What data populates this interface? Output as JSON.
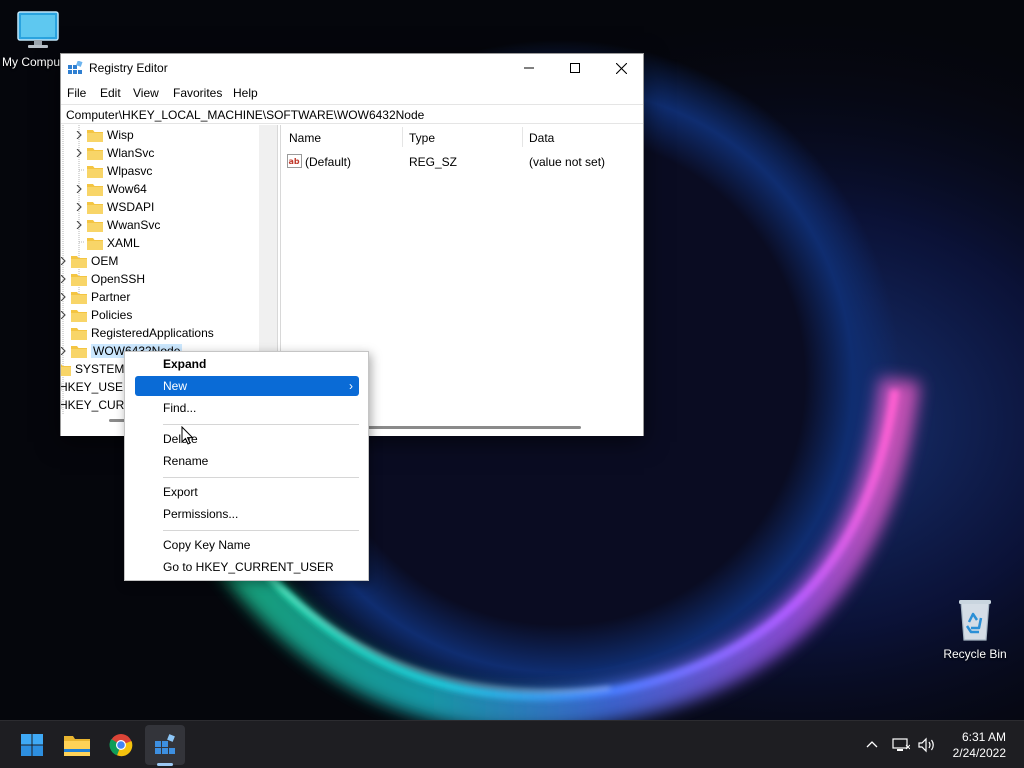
{
  "desktop": {
    "icons": [
      {
        "label": "My Computer"
      },
      {
        "label": "Recycle Bin"
      }
    ]
  },
  "window": {
    "title": "Registry Editor",
    "menu": [
      "File",
      "Edit",
      "View",
      "Favorites",
      "Help"
    ],
    "address": "Computer\\HKEY_LOCAL_MACHINE\\SOFTWARE\\WOW6432Node",
    "tree": [
      {
        "label": "Wisp",
        "expandable": true
      },
      {
        "label": "WlanSvc",
        "expandable": true
      },
      {
        "label": "Wlpasvc",
        "expandable": false
      },
      {
        "label": "Wow64",
        "expandable": true
      },
      {
        "label": "WSDAPI",
        "expandable": true
      },
      {
        "label": "WwanSvc",
        "expandable": true
      },
      {
        "label": "XAML",
        "expandable": false
      },
      {
        "label": "OEM",
        "expandable": true
      },
      {
        "label": "OpenSSH",
        "expandable": true
      },
      {
        "label": "Partner",
        "expandable": true
      },
      {
        "label": "Policies",
        "expandable": true
      },
      {
        "label": "RegisteredApplications",
        "expandable": false
      },
      {
        "label": "WOW6432Node",
        "expandable": true,
        "selected": true
      },
      {
        "label": "SYSTEM",
        "expandable": true
      },
      {
        "label": "HKEY_USERS",
        "expandable": true
      },
      {
        "label": "HKEY_CURRENT_CONFIG",
        "expandable": true
      }
    ],
    "columns": [
      "Name",
      "Type",
      "Data"
    ],
    "values": [
      {
        "name": "(Default)",
        "type": "REG_SZ",
        "data": "(value not set)"
      }
    ]
  },
  "context_menu": {
    "items": [
      {
        "label": "Expand",
        "bold": true
      },
      {
        "label": "New",
        "highlighted": true,
        "submenu": true
      },
      {
        "label": "Find..."
      },
      {
        "label": "Delete"
      },
      {
        "label": "Rename"
      },
      {
        "label": "Export"
      },
      {
        "label": "Permissions..."
      },
      {
        "label": "Copy Key Name"
      },
      {
        "label": "Go to HKEY_CURRENT_USER"
      }
    ]
  },
  "taskbar": {
    "apps": [
      "start-icon",
      "file-explorer-icon",
      "chrome-icon",
      "registry-editor-icon"
    ],
    "time": "6:31 AM",
    "date": "2/24/2022"
  },
  "colors": {
    "accent": "#0a6bd6",
    "selection": "#cce8ff",
    "folder": "#f4c542",
    "taskbar": "#1e1e22"
  }
}
